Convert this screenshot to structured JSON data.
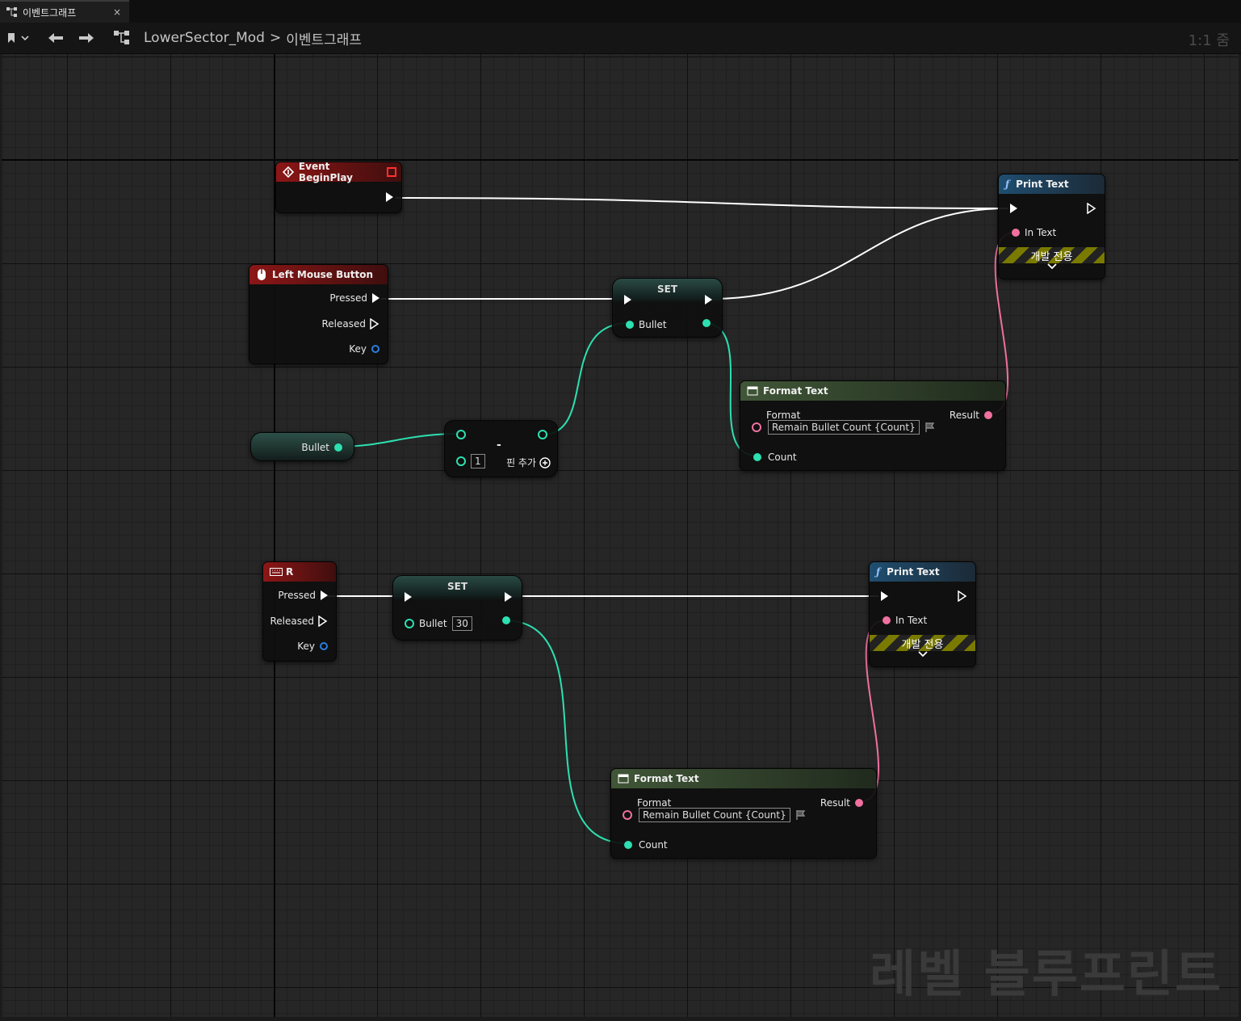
{
  "tab": {
    "label": "이벤트그래프",
    "close": "×"
  },
  "toolbar": {
    "breadcrumb_root": "LowerSector_Mod",
    "breadcrumb_sep": ">",
    "breadcrumb_current": "이벤트그래프",
    "zoom": "1:1 줌"
  },
  "watermark": "레벨 블루프린트",
  "nodes": {
    "begin_play": {
      "title": "Event BeginPlay"
    },
    "left_mouse": {
      "title": "Left Mouse Button",
      "pressed": "Pressed",
      "released": "Released",
      "key": "Key"
    },
    "set_top": {
      "title": "SET",
      "var": "Bullet"
    },
    "print_top": {
      "title": "Print Text",
      "in_text": "In Text",
      "dev_only": "개발 전용"
    },
    "bullet_get": {
      "label": "Bullet"
    },
    "subtract": {
      "op": "-",
      "value": "1",
      "add_pin": "핀 추가"
    },
    "format_top": {
      "title": "Format Text",
      "format": "Format",
      "format_value": "Remain Bullet Count {Count}",
      "result": "Result",
      "count": "Count"
    },
    "r_key": {
      "title": "R",
      "pressed": "Pressed",
      "released": "Released",
      "key": "Key"
    },
    "set_bottom": {
      "title": "SET",
      "var": "Bullet",
      "value": "30"
    },
    "print_bottom": {
      "title": "Print Text",
      "in_text": "In Text",
      "dev_only": "개발 전용"
    },
    "format_bottom": {
      "title": "Format Text",
      "format": "Format",
      "format_value": "Remain Bullet Count {Count}",
      "result": "Result",
      "count": "Count"
    }
  },
  "colors": {
    "exec": "#ffffff",
    "integer": "#2de0b0",
    "text": "#f070a0",
    "struct": "#2a7de0"
  }
}
